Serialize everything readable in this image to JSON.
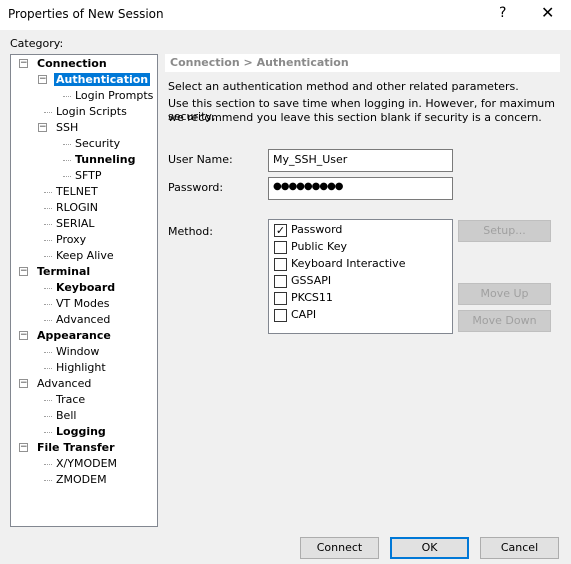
{
  "window": {
    "title": "Properties of New Session",
    "help": "?",
    "close": "✕"
  },
  "category_label": "Category:",
  "tree": [
    {
      "label": "Connection",
      "level": 0,
      "bold": true,
      "expander": "minus"
    },
    {
      "label": "Authentication",
      "level": 1,
      "bold": true,
      "selected": true,
      "expander": "minus"
    },
    {
      "label": "Login Prompts",
      "level": 2
    },
    {
      "label": "Login Scripts",
      "level": 1
    },
    {
      "label": "SSH",
      "level": 1,
      "expander": "minus"
    },
    {
      "label": "Security",
      "level": 2
    },
    {
      "label": "Tunneling",
      "level": 2,
      "bold": true
    },
    {
      "label": "SFTP",
      "level": 2
    },
    {
      "label": "TELNET",
      "level": 1
    },
    {
      "label": "RLOGIN",
      "level": 1
    },
    {
      "label": "SERIAL",
      "level": 1
    },
    {
      "label": "Proxy",
      "level": 1
    },
    {
      "label": "Keep Alive",
      "level": 1
    },
    {
      "label": "Terminal",
      "level": 0,
      "bold": true,
      "expander": "minus"
    },
    {
      "label": "Keyboard",
      "level": 1,
      "bold": true
    },
    {
      "label": "VT Modes",
      "level": 1
    },
    {
      "label": "Advanced",
      "level": 1
    },
    {
      "label": "Appearance",
      "level": 0,
      "bold": true,
      "expander": "minus"
    },
    {
      "label": "Window",
      "level": 1
    },
    {
      "label": "Highlight",
      "level": 1
    },
    {
      "label": "Advanced",
      "level": 0,
      "expander": "minus"
    },
    {
      "label": "Trace",
      "level": 1
    },
    {
      "label": "Bell",
      "level": 1
    },
    {
      "label": "Logging",
      "level": 1,
      "bold": true
    },
    {
      "label": "File Transfer",
      "level": 0,
      "bold": true,
      "expander": "minus"
    },
    {
      "label": "X/YMODEM",
      "level": 1
    },
    {
      "label": "ZMODEM",
      "level": 1
    }
  ],
  "panel": {
    "breadcrumb": "Connection > Authentication",
    "intro": "Select an authentication method and other related parameters.",
    "note_line1": "Use this section to save time when logging in. However, for maximum security,",
    "note_line2": "we recommend you leave this section blank if security is a concern.",
    "username_label": "User Name:",
    "username_value": "My_SSH_User",
    "password_label": "Password:",
    "password_value": "●●●●●●●●●",
    "method_label": "Method:",
    "methods": [
      {
        "label": "Password",
        "checked": true
      },
      {
        "label": "Public Key",
        "checked": false
      },
      {
        "label": "Keyboard Interactive",
        "checked": false
      },
      {
        "label": "GSSAPI",
        "checked": false
      },
      {
        "label": "PKCS11",
        "checked": false
      },
      {
        "label": "CAPI",
        "checked": false
      }
    ],
    "setup": "Setup...",
    "move_up": "Move Up",
    "move_down": "Move Down"
  },
  "footer": {
    "connect": "Connect",
    "ok": "OK",
    "cancel": "Cancel"
  },
  "colors": {
    "selection": "#0078d7"
  }
}
